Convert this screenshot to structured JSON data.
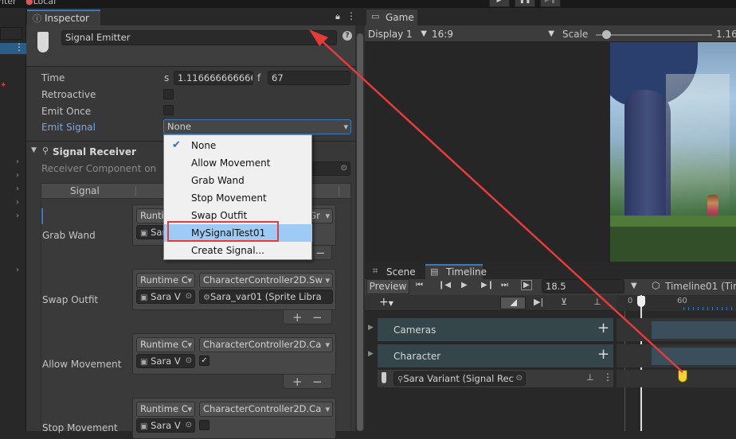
{
  "topbar": {
    "left_fragment": "nter",
    "local_label": "Local",
    "play_icon": "play-icon",
    "pause_icon": "pause-icon",
    "step_icon": "step-icon"
  },
  "inspector": {
    "tab_label": "Inspector",
    "object_name": "Signal Emitter",
    "fields": {
      "time_label": "Time",
      "time_s_prefix": "s",
      "time_value": "1.1166666666666",
      "time_f_prefix": "f",
      "frame_value": "67",
      "retroactive_label": "Retroactive",
      "emit_once_label": "Emit Once",
      "emit_signal_label": "Emit Signal",
      "emit_signal_value": "None"
    },
    "signal_receiver": {
      "header": "Signal Receiver",
      "receiver_component_label": "Receiver Component on",
      "signal_column": "Signal",
      "entries": [
        {
          "signal": "Grab Wand",
          "mode": "Runtime C",
          "function": "CharacterController2D.Gr",
          "object": "Sara",
          "arg": ""
        },
        {
          "signal": "Swap Outfit",
          "mode": "Runtime C",
          "function": "CharacterController2D.Sw",
          "object": "Sara V",
          "arg": "Sara_var01 (Sprite Libra"
        },
        {
          "signal": "Allow Movement",
          "mode": "Runtime C",
          "function": "CharacterController2D.Ca",
          "object": "Sara V",
          "arg": ""
        },
        {
          "signal": "Stop Movement",
          "mode": "Runtime C",
          "function": "CharacterController2D.Ca",
          "object": "Sara V",
          "arg": ""
        }
      ],
      "add_label": "+",
      "remove_label": "−"
    }
  },
  "dropdown_menu": {
    "items": [
      {
        "label": "None",
        "checked": true,
        "highlighted": false
      },
      {
        "label": "Allow Movement",
        "checked": false,
        "highlighted": false
      },
      {
        "label": "Grab Wand",
        "checked": false,
        "highlighted": false
      },
      {
        "label": "Stop Movement",
        "checked": false,
        "highlighted": false
      },
      {
        "label": "Swap Outfit",
        "checked": false,
        "highlighted": false
      },
      {
        "label": "MySignalTest01",
        "checked": false,
        "highlighted": true
      },
      {
        "label": "Create Signal...",
        "checked": false,
        "highlighted": false
      }
    ]
  },
  "game": {
    "tab_label": "Game",
    "display_value": "Display 1",
    "aspect_value": "16:9",
    "scale_label": "Scale",
    "scale_value": "1.16",
    "scale_slider_level": 0.05
  },
  "timeline": {
    "scene_tab": "Scene",
    "timeline_tab": "Timeline",
    "preview_label": "Preview",
    "frame_value": "18.5",
    "asset_name": "Timeline01 (Tim",
    "ruler_labels": [
      "0",
      "60"
    ],
    "tracks": [
      {
        "name": "Cameras"
      },
      {
        "name": "Character"
      }
    ],
    "signal_track": "Sara Variant (Signal Rec"
  },
  "colors": {
    "annotation_red": "#e63b3b",
    "highlight_blue": "#9ecbf6",
    "link_blue": "#7aa8e6"
  }
}
